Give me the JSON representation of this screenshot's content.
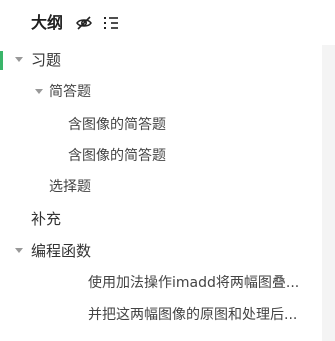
{
  "outline": {
    "title": "大纲",
    "icons": {
      "hide": "eye-off-icon",
      "list": "list-icon"
    },
    "items": [
      {
        "label": "习题",
        "level": 1,
        "expanded": true,
        "active": true
      },
      {
        "label": "简答题",
        "level": 2,
        "expanded": true,
        "active": false
      },
      {
        "label": "含图像的简答题",
        "level": 3,
        "active": false
      },
      {
        "label": "含图像的简答题",
        "level": 3,
        "active": false
      },
      {
        "label": "选择题",
        "level": 2,
        "active": false
      },
      {
        "label": "补充",
        "level": 1,
        "active": false
      },
      {
        "label": "编程函数",
        "level": 1,
        "expanded": true,
        "active": false
      },
      {
        "label": "使用加法操作imadd将两幅图叠...",
        "level": 3,
        "active": false
      },
      {
        "label": "并把这两幅图像的原图和处理后...",
        "level": 3,
        "active": false
      }
    ]
  },
  "colors": {
    "active_marker": "#3ab56a",
    "text": "#333333",
    "caret": "#999999",
    "scrollbar": "#f4f4f4"
  }
}
